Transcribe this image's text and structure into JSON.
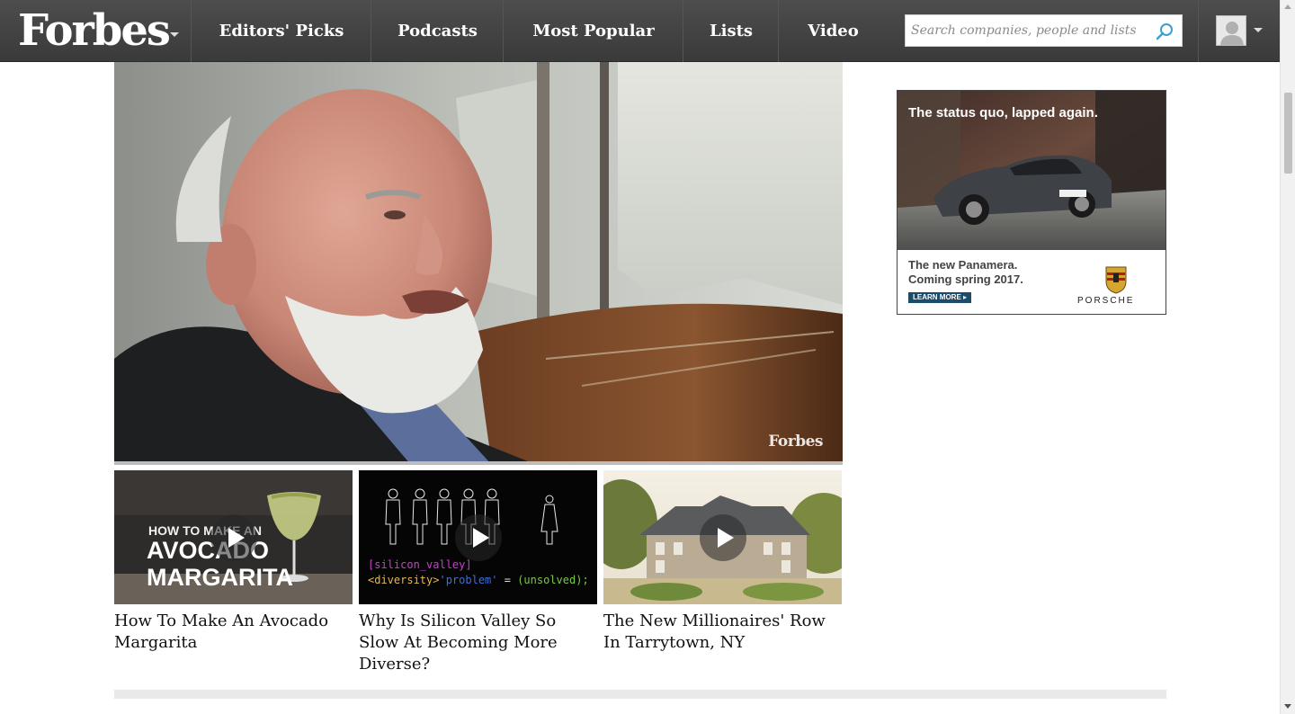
{
  "header": {
    "logo": "Forbes",
    "nav_items": [
      {
        "label": "Editors' Picks"
      },
      {
        "label": "Podcasts"
      },
      {
        "label": "Most Popular"
      },
      {
        "label": "Lists"
      },
      {
        "label": "Video"
      }
    ],
    "search_placeholder": "Search companies, people and lists"
  },
  "main_video": {
    "watermark": "Forbes",
    "progress": 0.0
  },
  "related_videos": [
    {
      "title": "How To Make An Avocado Margarita",
      "overlay_lines": [
        "HOW TO MAKE AN",
        "AVOCADO",
        "MARGARITA"
      ]
    },
    {
      "title": "Why Is Silicon Valley So Slow At Becoming More Diverse?",
      "overlay_code_1": "[silicon_valley]",
      "overlay_code_2a": "<diversity>",
      "overlay_code_2b": "'problem'",
      "overlay_code_2c": " = ",
      "overlay_code_2d": "(unsolved);"
    },
    {
      "title": "The New Millionaires' Row In Tarrytown, NY"
    }
  ],
  "ad": {
    "headline": "The status quo, lapped again.",
    "sub_line_1": "The new Panamera.",
    "sub_line_2": "Coming spring 2017.",
    "cta": "LEARN MORE ▸",
    "brand": "PORSCHE"
  },
  "colors": {
    "nav_bg": "#444444",
    "link_text": "#111111",
    "ad_cta": "#1b4d6b"
  }
}
